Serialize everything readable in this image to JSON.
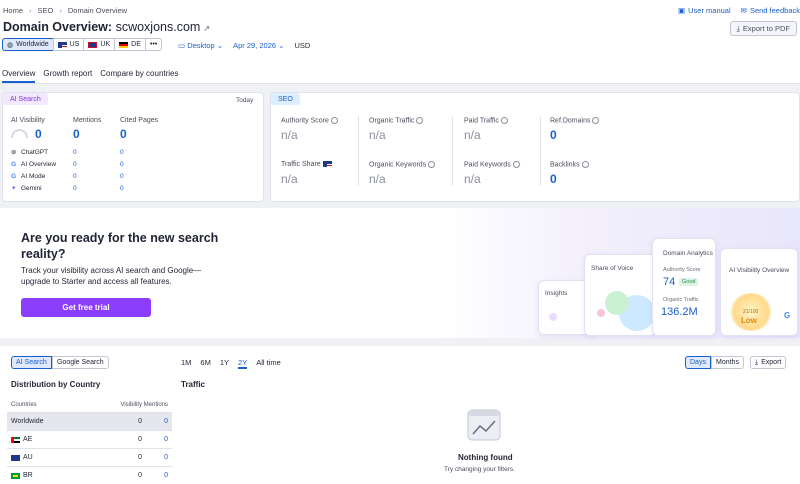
{
  "breadcrumbs": [
    "Home",
    "SEO",
    "Domain Overview"
  ],
  "top_links": {
    "user_manual": "User manual",
    "feedback": "Send feedback"
  },
  "title": {
    "prefix": "Domain Overview:",
    "domain": "scwoxjons.com"
  },
  "export_pdf": "Export to PDF",
  "databases": [
    {
      "label": "Worldwide",
      "active": true
    },
    {
      "label": "US"
    },
    {
      "label": "UK"
    },
    {
      "label": "DE"
    },
    {
      "label": "•••"
    }
  ],
  "filters": {
    "device": "Desktop",
    "date": "Apr 29, 2026",
    "currency": "USD"
  },
  "tabs": [
    "Overview",
    "Growth report",
    "Compare by countries"
  ],
  "ai_card": {
    "chip": "AI Search",
    "today": "Today",
    "visibility_label": "AI Visibility",
    "visibility_value": "0",
    "mentions_label": "Mentions",
    "mentions_value": "0",
    "cited_label": "Cited Pages",
    "cited_value": "0",
    "rows": [
      {
        "name": "ChatGPT",
        "mentions": "0",
        "cited": "0"
      },
      {
        "name": "AI Overview",
        "mentions": "0",
        "cited": "0"
      },
      {
        "name": "AI Mode",
        "mentions": "0",
        "cited": "0"
      },
      {
        "name": "Gemini",
        "mentions": "0",
        "cited": "0"
      }
    ]
  },
  "seo_card": {
    "chip": "SEO",
    "metrics": [
      {
        "label": "Authority Score",
        "value": "n/a"
      },
      {
        "label": "Organic Traffic",
        "value": "n/a"
      },
      {
        "label": "Paid Traffic",
        "value": "n/a"
      },
      {
        "label": "Ref.Domains",
        "value": "0"
      },
      {
        "label": "Traffic Share",
        "value": "n/a"
      },
      {
        "label": "Organic Keywords",
        "value": "n/a"
      },
      {
        "label": "Paid Keywords",
        "value": "n/a"
      },
      {
        "label": "Backlinks",
        "value": "0"
      }
    ]
  },
  "promo": {
    "heading": "Are you ready for the new search reality?",
    "body": "Track your visibility across AI search and Google—upgrade to Starter and access all features.",
    "cta": "Get free trial",
    "cards": {
      "insights": "Insights",
      "share": "Share of Voice",
      "domain": "Domain Analytics",
      "authority_label": "Authority Score",
      "authority_value": "74",
      "authority_badge": "Good",
      "traffic_label": "Organic Traffic",
      "traffic_value": "136.2M",
      "ai_vis": "AI Visibility Overview",
      "gauge_value": "21/100",
      "gauge_label": "Low"
    }
  },
  "bottom": {
    "toggle": [
      "AI Search",
      "Google Search"
    ],
    "periods": [
      "1M",
      "6M",
      "1Y",
      "2Y",
      "All time"
    ],
    "active_period": "2Y",
    "days": "Days",
    "months": "Months",
    "export": "Export",
    "dist_title": "Distribution by Country",
    "traffic_title": "Traffic",
    "table_headers": [
      "Countries",
      "Visibility",
      "Mentions"
    ],
    "table_rows": [
      {
        "country": "Worldwide",
        "visibility": "0",
        "mentions": "0"
      },
      {
        "country": "AE",
        "visibility": "0",
        "mentions": "0"
      },
      {
        "country": "AU",
        "visibility": "0",
        "mentions": "0"
      },
      {
        "country": "BR",
        "visibility": "0",
        "mentions": "0"
      }
    ],
    "empty_title": "Nothing found",
    "empty_sub": "Try changing your filters."
  },
  "colors": {
    "accent": "#1a5fcf",
    "cta": "#8b3ffc",
    "ai_chip": "#f3e8ff",
    "seo_chip": "#ddeeff"
  }
}
